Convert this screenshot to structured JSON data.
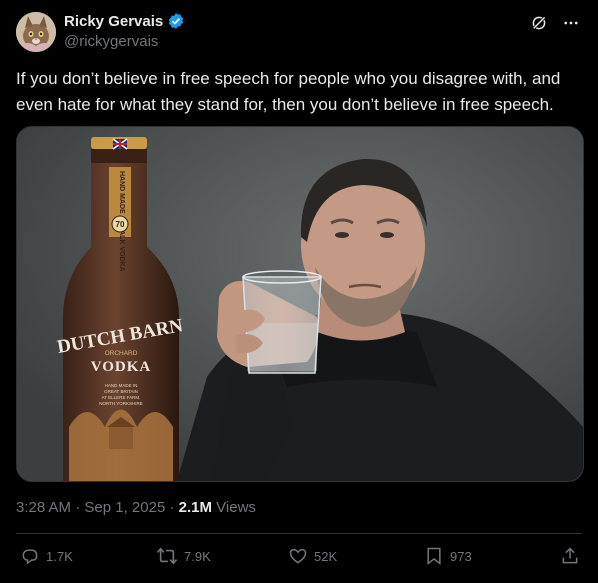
{
  "author": {
    "name": "Ricky Gervais",
    "handle": "@rickygervais"
  },
  "post": {
    "text": "If you don’t believe in free speech for people who you disagree with, and even hate for what they stand for, then you don’t believe in free speech."
  },
  "media": {
    "bottle": {
      "brand": "DUTCH BARN",
      "sub": "ORCHARD",
      "product": "VODKA",
      "abv": "70",
      "small_text": "HAND MADE IN GREAT BRITAIN AT ELLERS FARM, NORTH YORKSHIRE"
    }
  },
  "meta": {
    "time": "3:28 AM",
    "date": "Sep 1, 2025",
    "views_count": "2.1M",
    "views_label": "Views"
  },
  "actions": {
    "replies": "1.7K",
    "reposts": "7.9K",
    "likes": "52K",
    "bookmarks": "973"
  },
  "colors": {
    "background": "#000000",
    "text_primary": "#e7e9ea",
    "text_secondary": "#71767b",
    "verified_blue": "#1d9bf0",
    "divider": "#2f3336"
  },
  "icons": [
    "verified-badge-icon",
    "grok-icon",
    "more-icon",
    "reply-icon",
    "repost-icon",
    "like-icon",
    "bookmark-icon",
    "share-icon"
  ]
}
